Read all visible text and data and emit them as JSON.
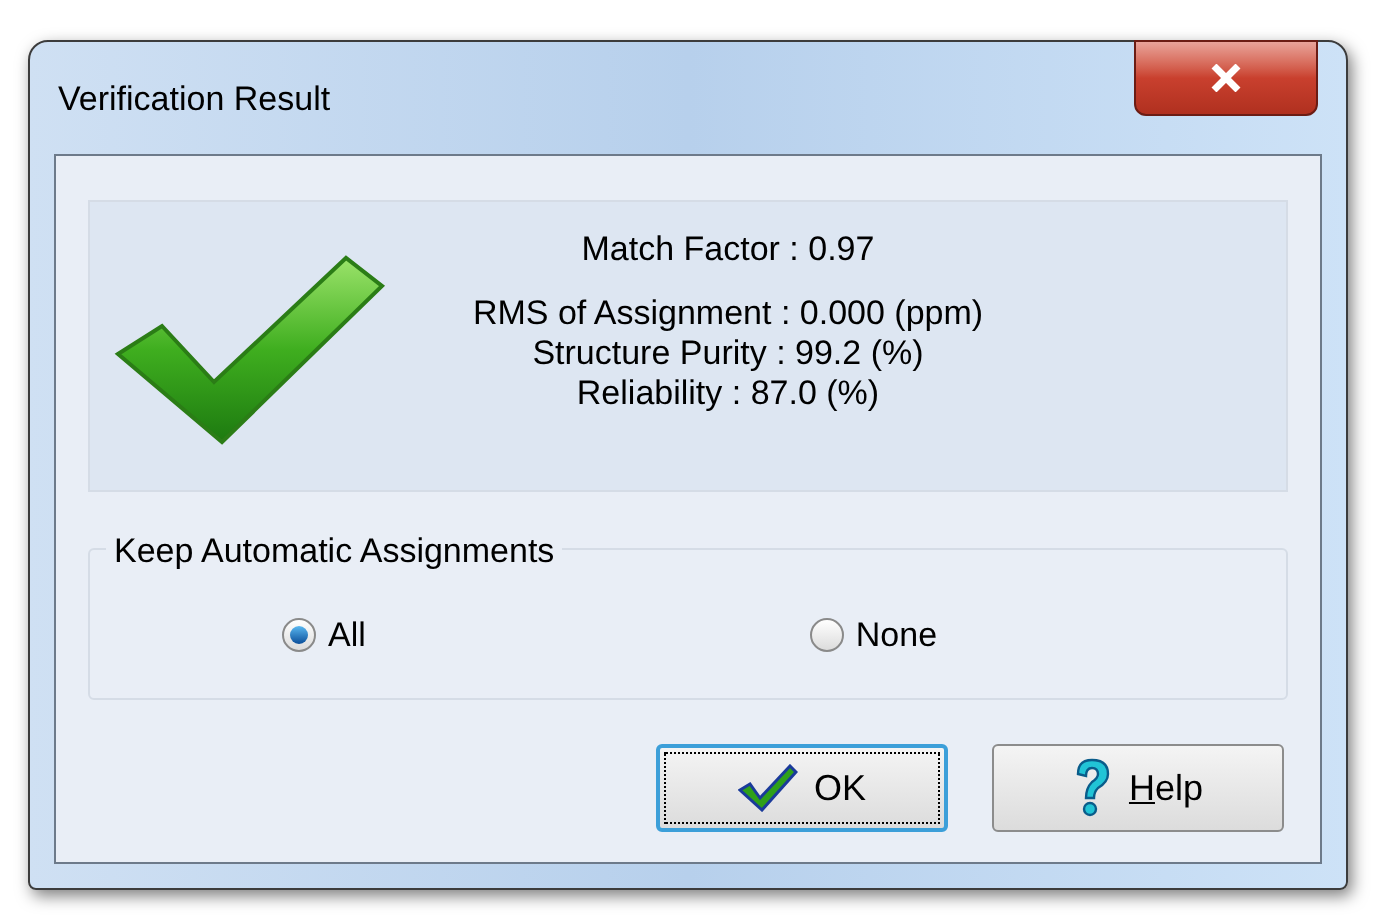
{
  "window": {
    "title": "Verification Result"
  },
  "results": {
    "match_factor": "Match Factor : 0.97",
    "lines": [
      "RMS of Assignment : 0.000 (ppm)",
      "Structure Purity : 99.2 (%)",
      "Reliability : 87.0 (%)"
    ]
  },
  "group": {
    "title": "Keep Automatic Assignments",
    "options": [
      {
        "label": "All",
        "selected": true
      },
      {
        "label": "None",
        "selected": false
      }
    ]
  },
  "buttons": [
    {
      "kind": "ok",
      "label": "OK",
      "focused": true
    },
    {
      "kind": "help",
      "label": "Help",
      "focused": false,
      "mnemonic_underlined": true
    }
  ]
}
